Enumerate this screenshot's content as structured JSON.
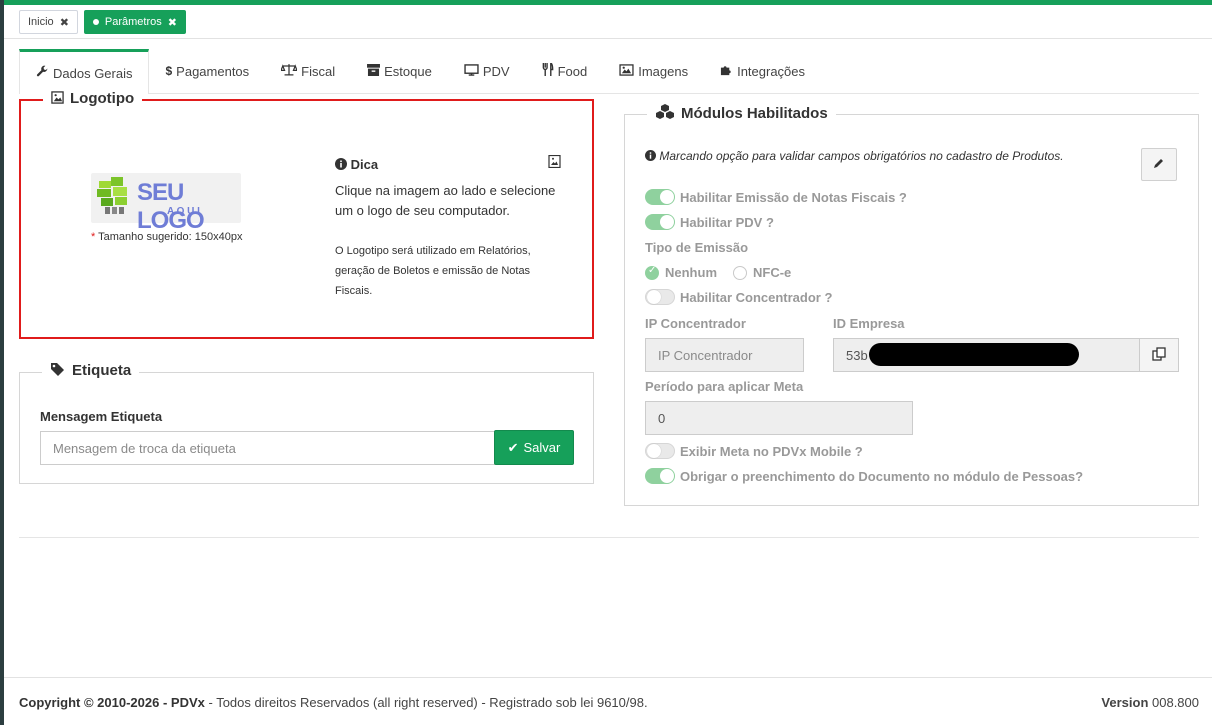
{
  "page_tabs": [
    {
      "label": "Inicio"
    },
    {
      "label": "Parâmetros"
    }
  ],
  "nav_tabs": [
    {
      "label": "Dados Gerais",
      "icon": "wrench-icon"
    },
    {
      "label": "Pagamentos",
      "icon": "dollar-icon"
    },
    {
      "label": "Fiscal",
      "icon": "balance-scale-icon"
    },
    {
      "label": "Estoque",
      "icon": "archive-icon"
    },
    {
      "label": "PDV",
      "icon": "monitor-icon"
    },
    {
      "label": "Food",
      "icon": "cutlery-icon"
    },
    {
      "label": "Imagens",
      "icon": "image-icon"
    },
    {
      "label": "Integrações",
      "icon": "puzzle-icon"
    }
  ],
  "logotipo": {
    "title": "Logotipo",
    "logo_text": "SEU LOGO",
    "logo_sub": "A Q U I",
    "required_mark": "*",
    "size_hint": "Tamanho sugerido: 150x40px",
    "dica_title": "Dica",
    "dica_text": "Clique na imagem ao lado e selecione um o logo de seu computador.",
    "dica_small": "O Logotipo será utilizado em Relatórios, geração de Boletos e emissão de Notas Fiscais."
  },
  "etiqueta": {
    "title": "Etiqueta",
    "label": "Mensagem Etiqueta",
    "placeholder": "Mensagem de troca da etiqueta",
    "save_label": "Salvar"
  },
  "modulos": {
    "title": "Módulos Habilitados",
    "info": "Marcando opção para validar campos obrigatórios no cadastro de Produtos.",
    "sw_nfe": "Habilitar Emissão de Notas Fiscais ?",
    "sw_pdv": "Habilitar PDV ?",
    "tipo_emissao": "Tipo de Emissão",
    "radio_nenhum": "Nenhum",
    "radio_nfce": "NFC-e",
    "sw_concentrador": "Habilitar Concentrador ?",
    "ip_label": "IP Concentrador",
    "ip_placeholder": "IP Concentrador",
    "id_label": "ID Empresa",
    "id_value": "53b",
    "periodo_label": "Período para aplicar Meta",
    "periodo_value": "0",
    "sw_meta": "Exibir Meta no PDVx Mobile ?",
    "sw_doc": "Obrigar o preenchimento do Documento no módulo de Pessoas?"
  },
  "footer": {
    "copyright_prefix": "Copyright © 2010-2026 - ",
    "brand": "PDVx",
    "rights": " - Todos direitos Reservados (all right reserved) - Registrado sob lei 9610/98.",
    "version_label": "Version",
    "version_value": " 008.800"
  },
  "colors": {
    "accent": "#16a05a",
    "highlight_border": "#e01b1b"
  }
}
